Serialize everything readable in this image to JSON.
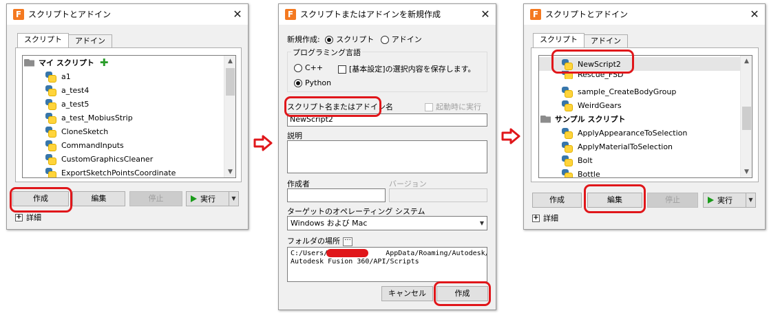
{
  "dialog1": {
    "title": "スクリプトとアドイン",
    "tabs": [
      "スクリプト",
      "アドイン"
    ],
    "group": "マイ スクリプト",
    "items": [
      "a1",
      "a_test4",
      "a_test5",
      "a_test_MobiusStrip",
      "CloneSketch",
      "CommandInputs",
      "CustomGraphicsCleaner",
      "ExportSketchPointsCoordinate"
    ],
    "buttons": {
      "create": "作成",
      "edit": "編集",
      "stop": "停止",
      "run": "実行"
    },
    "details": "詳細"
  },
  "dialog2": {
    "title": "スクリプトまたはアドインを新規作成",
    "new_create_label": "新規作成:",
    "radio_script": "スクリプト",
    "radio_addin": "アドイン",
    "lang_group": "プログラミング言語",
    "cpp": "C++",
    "python": "Python",
    "save_default": "[基本設定]の選択内容を保存します。",
    "name_label": "スクリプト名またはアドイン名",
    "run_on_startup": "起動時に実行",
    "name_value": "NewScript2",
    "desc_label": "説明",
    "author_label": "作成者",
    "version_label": "バージョン",
    "os_label": "ターゲットのオペレーティング システム",
    "os_value": "Windows および Mac",
    "folder_label": "フォルダの場所",
    "folder_line1_prefix": "C:/Users/",
    "folder_line1_suffix": "AppData/Roaming/Autodesk/",
    "folder_line2": "Autodesk Fusion 360/API/Scripts",
    "cancel": "キャンセル",
    "create": "作成"
  },
  "dialog3": {
    "title": "スクリプトとアドイン",
    "tabs": [
      "スクリプト",
      "アドイン"
    ],
    "items_top": [
      "NewScript2",
      "Rescue_FSD",
      "sample_CreateBodyGroup",
      "WeirdGears"
    ],
    "group": "サンプル スクリプト",
    "items_bottom": [
      "ApplyAppearanceToSelection",
      "ApplyMaterialToSelection",
      "Bolt",
      "Bottle"
    ],
    "buttons": {
      "create": "作成",
      "edit": "編集",
      "stop": "停止",
      "run": "実行"
    },
    "details": "詳細"
  },
  "colors": {
    "highlight": "#e0161a",
    "accent": "#f47920"
  }
}
